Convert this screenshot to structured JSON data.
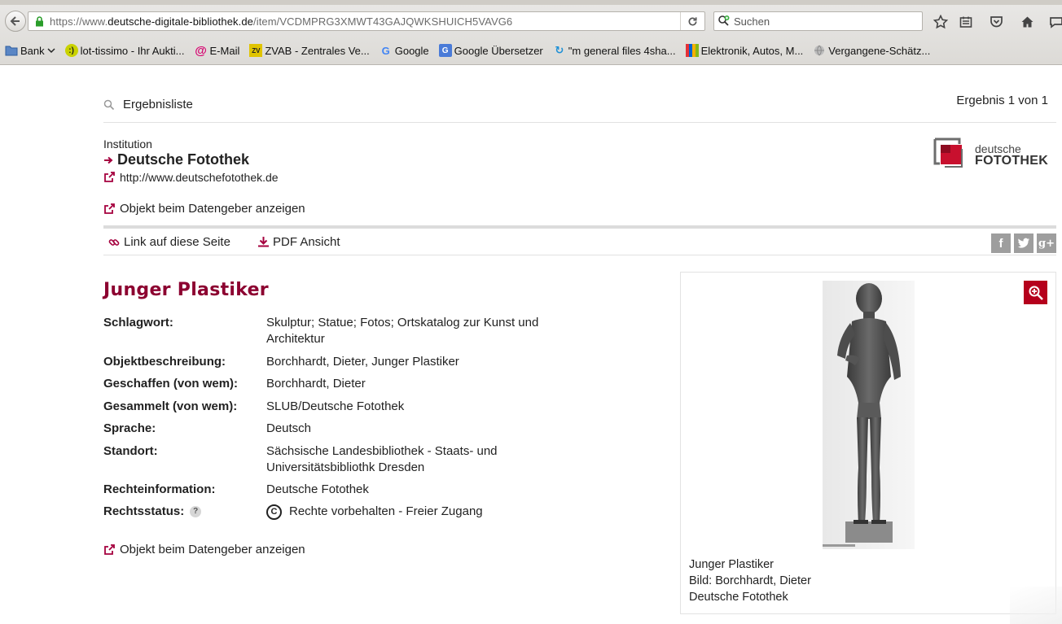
{
  "browser": {
    "url_prefix": "https://www.",
    "url_domain": "deutsche-digitale-bibliothek.de",
    "url_path": "/item/VCDMPRG3XMWT43GAJQWKSHUICH5VAVG6",
    "search_placeholder": "Suchen",
    "bookmarks": [
      {
        "label": "Bank",
        "icon": "folder-icon"
      },
      {
        "label": "lot-tissimo - Ihr Aukti...",
        "icon": "smiley-icon"
      },
      {
        "label": "E-Mail",
        "icon": "at-icon"
      },
      {
        "label": "ZVAB - Zentrales Ve...",
        "icon": "zvab-icon"
      },
      {
        "label": "Google",
        "icon": "google-icon"
      },
      {
        "label": "Google Übersetzer",
        "icon": "translate-icon"
      },
      {
        "label": "\"m general files 4sha...",
        "icon": "4shared-icon"
      },
      {
        "label": "Elektronik, Autos, M...",
        "icon": "ebay-icon"
      },
      {
        "label": "Vergangene-Schätz...",
        "icon": "globe-icon"
      }
    ]
  },
  "page": {
    "results_link": "Ergebnisliste",
    "results_count": "Ergebnis 1 von 1",
    "institution_label": "Institution",
    "institution_name": "Deutsche Fotothek",
    "institution_url": "http://www.deutschefotothek.de",
    "object_link": "Objekt beim Datengeber anzeigen",
    "logo_line1": "deutsche",
    "logo_line2": "FOTOTHEK",
    "tools": {
      "link_page": "Link auf diese Seite",
      "pdf": "PDF Ansicht"
    },
    "title": "Junger Plastiker",
    "metadata": [
      {
        "key": "Schlagwort:",
        "value": "Skulptur; Statue; Fotos; Ortskatalog zur Kunst und Architektur"
      },
      {
        "key": "Objektbeschreibung:",
        "value": "Borchhardt, Dieter, Junger Plastiker"
      },
      {
        "key": "Geschaffen (von wem):",
        "value": "Borchhardt, Dieter"
      },
      {
        "key": "Gesammelt (von wem):",
        "value": "SLUB/Deutsche Fotothek"
      },
      {
        "key": "Sprache:",
        "value": "Deutsch"
      },
      {
        "key": "Standort:",
        "value": "Sächsische Landesbibliothek - Staats- und Universitätsbibliothk Dresden"
      },
      {
        "key": "Rechteinformation:",
        "value": "Deutsche Fotothek"
      },
      {
        "key": "Rechtsstatus:",
        "value": "Rechte vorbehalten - Freier Zugang"
      }
    ],
    "help_badge": "?",
    "copyright_symbol": "C",
    "preview": {
      "caption_title": "Junger Plastiker",
      "caption_image": "Bild: Borchhardt, Dieter",
      "caption_source": "Deutsche Fotothek"
    },
    "colors": {
      "accent": "#a5003e",
      "title": "#8c0030",
      "zoom": "#b5001c"
    }
  }
}
